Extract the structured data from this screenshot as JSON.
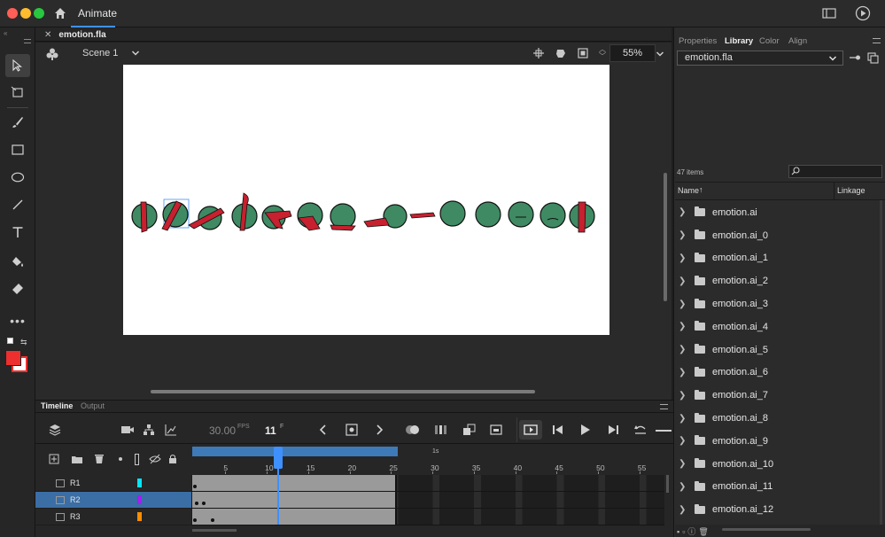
{
  "app": {
    "title": "Animate"
  },
  "document": {
    "tab_name": "emotion.fla",
    "scene": "Scene 1",
    "zoom": "55%"
  },
  "panels": {
    "tabs": [
      "Properties",
      "Library",
      "Color",
      "Align"
    ],
    "library": {
      "file": "emotion.fla",
      "count": "47 items",
      "col_name": "Name",
      "col_linkage": "Linkage",
      "items": [
        "emotion.ai",
        "emotion.ai_0",
        "emotion.ai_1",
        "emotion.ai_2",
        "emotion.ai_3",
        "emotion.ai_4",
        "emotion.ai_5",
        "emotion.ai_6",
        "emotion.ai_7",
        "emotion.ai_8",
        "emotion.ai_9",
        "emotion.ai_10",
        "emotion.ai_11",
        "emotion.ai_12"
      ]
    }
  },
  "timeline": {
    "tab": "Timeline",
    "output_tab": "Output",
    "fps": "30.00",
    "fps_unit": "FPS",
    "frame": "11",
    "frame_unit": "F",
    "ruler_sec": "1s",
    "ticks": [
      "5",
      "10",
      "15",
      "20",
      "25",
      "30",
      "35",
      "40",
      "45",
      "50",
      "55"
    ],
    "layers": [
      {
        "name": "R1",
        "color": "#00e5ff"
      },
      {
        "name": "R2",
        "color": "#a020f0"
      },
      {
        "name": "R3",
        "color": "#ff8c00"
      }
    ]
  },
  "colors": {
    "accent": "#3e90ff",
    "stroke": "#ee2f2f",
    "fill": "#ffffff"
  }
}
